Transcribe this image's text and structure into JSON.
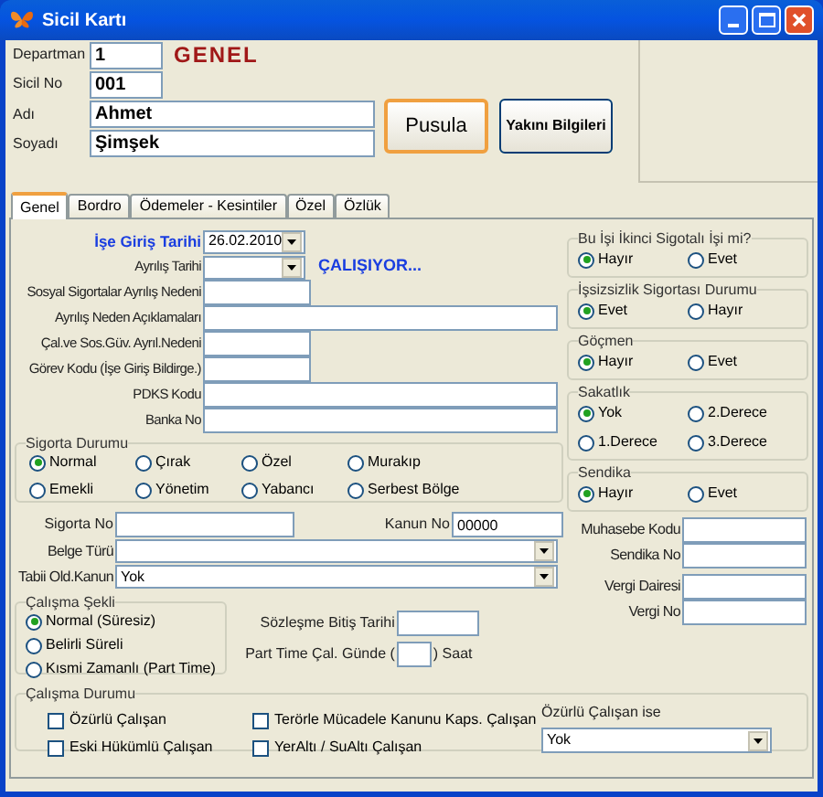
{
  "window": {
    "title": "Sicil Kartı"
  },
  "header": {
    "fields": [
      {
        "label": "Departman",
        "value": "1",
        "kind": "small"
      },
      {
        "label": "Sicil No",
        "value": "001",
        "kind": "small"
      },
      {
        "label": "Adı",
        "value": "Ahmet",
        "kind": "large"
      },
      {
        "label": "Soyadı",
        "value": "Şimşek",
        "kind": "large"
      }
    ],
    "section_title": "GENEL",
    "buttons": [
      {
        "label": "Pusula",
        "focused": true,
        "kind": "large"
      },
      {
        "label": "Yakını Bilgileri",
        "focused": false,
        "kind": "small"
      }
    ]
  },
  "tabs": [
    {
      "label": "Genel",
      "selected": true
    },
    {
      "label": "Bordro",
      "selected": false
    },
    {
      "label": "Ödemeler - Kesintiler",
      "selected": false
    },
    {
      "label": "Özel",
      "selected": false
    },
    {
      "label": "Özlük",
      "selected": false
    }
  ],
  "left_fields": [
    {
      "label": "İşe Giriş Tarihi",
      "value": "26.02.2010",
      "kind": "date",
      "highlight": true
    },
    {
      "label": "Ayrılış Tarihi",
      "kind": "date",
      "status": "ÇALIŞIYOR..."
    },
    {
      "label": "Sosyal Sigortalar Ayrılış Nedeni",
      "kind": "short"
    },
    {
      "label": "Ayrılış Neden Açıklamaları",
      "kind": "long"
    },
    {
      "label": "Çal.ve Sos.Güv. Ayrıl.Nedeni",
      "kind": "short"
    },
    {
      "label": "Görev Kodu (İşe Giriş Bildirge.)",
      "kind": "short"
    },
    {
      "label": "PDKS Kodu",
      "kind": "long"
    },
    {
      "label": "Banka No",
      "kind": "long"
    }
  ],
  "sigorta_durumu": {
    "title": "Sigorta Durumu",
    "options": [
      {
        "label": "Normal",
        "selected": true
      },
      {
        "label": "Çırak",
        "selected": false
      },
      {
        "label": "Özel",
        "selected": false
      },
      {
        "label": "Murakıp",
        "selected": false
      },
      {
        "label": "Emekli",
        "selected": false
      },
      {
        "label": "Yönetim",
        "selected": false
      },
      {
        "label": "Yabancı",
        "selected": false
      },
      {
        "label": "Serbest Bölge",
        "selected": false
      }
    ]
  },
  "sigorta_no": {
    "label": "Sigorta No"
  },
  "kanun_no": {
    "label": "Kanun No",
    "value": "00000"
  },
  "dropdowns": [
    {
      "label": "Belge Türü"
    },
    {
      "label": "Tabii Old.Kanun",
      "value": "Yok"
    }
  ],
  "calisma_sekli": {
    "title": "Çalışma Şekli",
    "options": [
      {
        "label": "Normal (Süresiz)",
        "selected": true
      },
      {
        "label": "Belirli Süreli",
        "selected": false
      },
      {
        "label": "Kısmi Zamanlı (Part Time)",
        "selected": false
      }
    ]
  },
  "sozlesme": {
    "label": "Sözleşme Bitiş Tarihi"
  },
  "part_time": {
    "label": "Part Time Çal. Günde (",
    "suffix": ") Saat"
  },
  "radio_groups": [
    {
      "title": "Bu İşi İkinci Sigotalı İşi mi?",
      "options": [
        {
          "label": "Hayır",
          "selected": true
        },
        {
          "label": "Evet",
          "selected": false
        }
      ]
    },
    {
      "title": "İşsizsizlik Sigortası Durumu",
      "options": [
        {
          "label": "Evet",
          "selected": true
        },
        {
          "label": "Hayır",
          "selected": false
        }
      ]
    },
    {
      "title": "Göçmen",
      "options": [
        {
          "label": "Hayır",
          "selected": true
        },
        {
          "label": "Evet",
          "selected": false
        }
      ]
    },
    {
      "title": "Sakatlık",
      "options": [
        {
          "label": "Yok",
          "selected": true
        },
        {
          "label": "2.Derece",
          "selected": false
        },
        {
          "label": "1.Derece",
          "selected": false
        },
        {
          "label": "3.Derece",
          "selected": false
        }
      ]
    },
    {
      "title": "Sendika",
      "options": [
        {
          "label": "Hayır",
          "selected": true
        },
        {
          "label": "Evet",
          "selected": false
        }
      ]
    }
  ],
  "right_fields": [
    {
      "label": "Muhasebe Kodu"
    },
    {
      "label": "Sendika No"
    },
    {
      "label": "Vergi Dairesi"
    },
    {
      "label": "Vergi No"
    }
  ],
  "calisma_durumu": {
    "title": "Çalışma Durumu",
    "checks": [
      {
        "label": "Özürlü Çalışan",
        "checked": false
      },
      {
        "label": "Terörle Mücadele Kanunu Kaps. Çalışan",
        "checked": false
      },
      {
        "label": "Eski Hükümlü Çalışan",
        "checked": false
      },
      {
        "label": "YerAltı / SuAltı Çalışan",
        "checked": false
      }
    ],
    "dropdown": {
      "label": "Özürlü Çalışan ise",
      "value": "Yok"
    }
  }
}
